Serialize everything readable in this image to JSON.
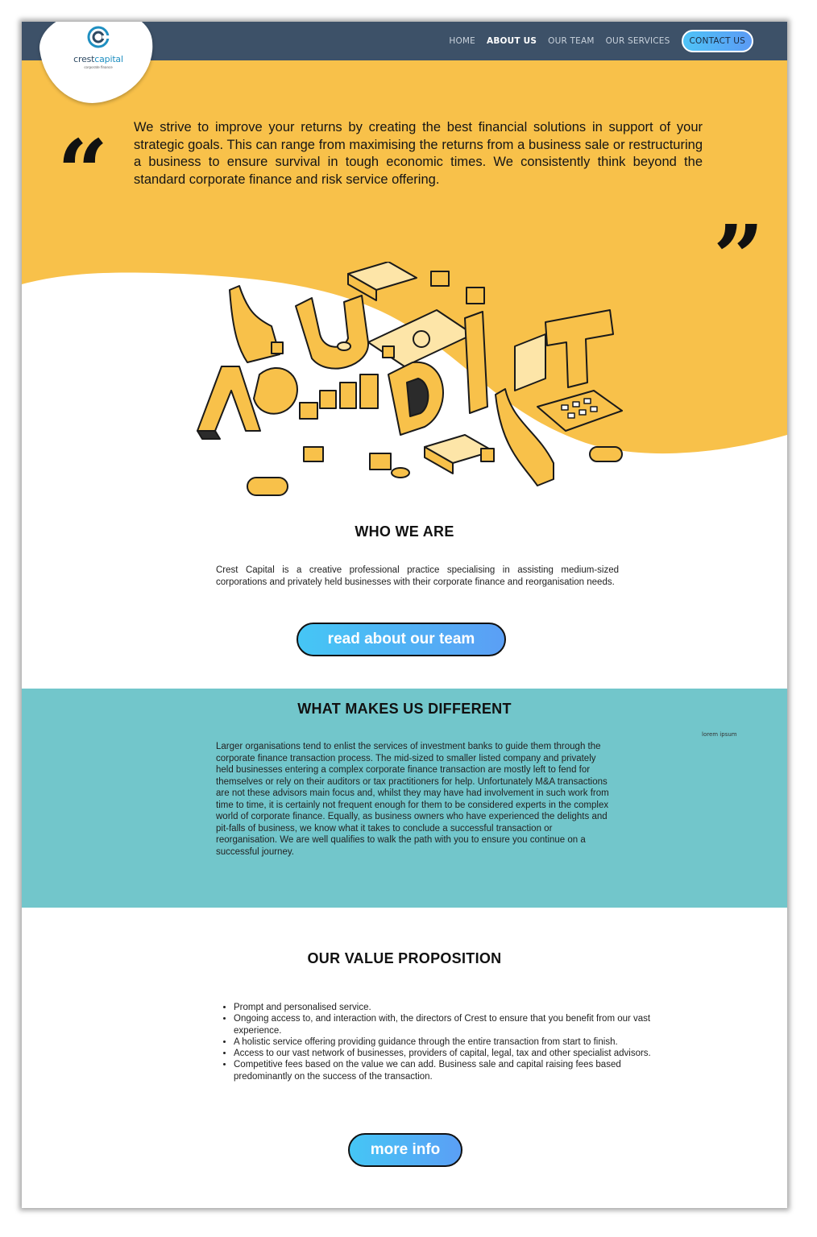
{
  "brand": {
    "name_part1": "crest",
    "name_part2": "capital",
    "tagline": "corporate finance",
    "colors": {
      "navy": "#3d5168",
      "yellow": "#f8c14a",
      "teal": "#72c6cb",
      "accent_blue": "#4fc3f7"
    }
  },
  "nav": {
    "items": [
      {
        "label": "HOME"
      },
      {
        "label": "ABOUT US",
        "active": true
      },
      {
        "label": "OUR TEAM"
      },
      {
        "label": "OUR SERVICES"
      }
    ],
    "cta_label": "CONTACT US"
  },
  "hero": {
    "quote_open": "“",
    "quote_close": "”",
    "mission": "We strive to improve your returns by creating the best financial solutions in support of your strategic goals. This can range from maximising the returns from a business sale or restructuring a business to ensure survival in tough economic times. We consistently think beyond the standard corporate finance and risk service offering.",
    "illustration_icon": "audit-isometric-illustration"
  },
  "who_we_are": {
    "title": "WHO WE ARE",
    "text": "Crest Capital is a creative professional practice specialising in assisting medium-sized corporations and privately held businesses with their corporate finance and reorganisation needs.",
    "button_label": "read about our team"
  },
  "different": {
    "title": "WHAT MAKES US DIFFERENT",
    "tiny_text": "lorem ipsum",
    "text": "Larger organisations tend to enlist the services of investment banks to guide them through the corporate finance transaction process. The mid-sized to smaller listed company and privately held businesses entering a complex corporate finance transaction are mostly left to fend for themselves or rely on their auditors or tax practitioners for help. Unfortunately M&A transactions are not these advisors main focus and, whilst they may have had involvement in such work from time to time, it is certainly not frequent enough for them to be considered experts in the complex world of corporate finance. Equally, as business owners who have experienced the delights and pit-falls of business, we know what it takes to conclude a successful transaction or reorganisation. We are well qualifies to walk the path with you to ensure you continue on a successful journey."
  },
  "value": {
    "title": "OUR VALUE PROPOSITION",
    "items": [
      "Prompt and personalised service.",
      "Ongoing access to, and interaction with, the directors of Crest to ensure that you benefit from our vast experience.",
      "A holistic service offering providing guidance through the entire transaction from start to finish.",
      "Access to our vast network of businesses, providers of capital, legal, tax and other specialist advisors.",
      "Competitive fees based on the value we can add. Business sale and capital raising fees based predominantly on the success of the transaction."
    ],
    "button_label": "more info"
  }
}
